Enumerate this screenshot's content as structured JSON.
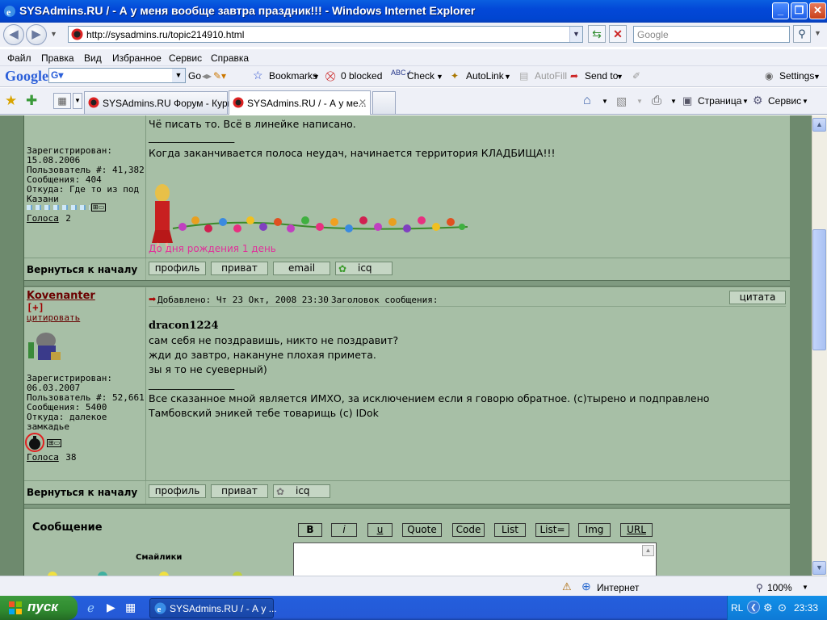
{
  "window": {
    "title": "SYSAdmins.RU / - А у меня вообще завтра праздник!!! - Windows Internet Explorer"
  },
  "address_bar": {
    "url": "http://sysadmins.ru/topic214910.html",
    "search_placeholder": "Google"
  },
  "menu": [
    "Файл",
    "Правка",
    "Вид",
    "Избранное",
    "Сервис",
    "Справка"
  ],
  "google_toolbar": {
    "logo": "Google",
    "go": "Go",
    "bookmarks": "Bookmarks",
    "blocked": "0 blocked",
    "check": "Check",
    "autolink": "AutoLink",
    "autofill": "AutoFill",
    "sendto": "Send to",
    "settings": "Settings"
  },
  "tabs": [
    {
      "label": "SYSAdmins.RU Форум - Кури..."
    },
    {
      "label": "SYSAdmins.RU / - А у ме..."
    }
  ],
  "command_bar": {
    "page": "Страница",
    "service": "Сервис"
  },
  "post1": {
    "left": {
      "registered_label": "Зарегистрирован:",
      "registered": "15.08.2006",
      "user_num": "Пользователь #: 41,382",
      "messages": "Сообщения: 404",
      "from": "Откуда: Где то из под Казани",
      "votes_link": "Голоса",
      "votes_count": ": 2"
    },
    "lines": [
      "Чё писать то. Всё в линейке написано.",
      "_________________",
      "Когда заканчивается полоса неудач, начинается территория КЛАДБИЩА!!!"
    ],
    "banner_text": "До дня рождения 1 день",
    "back_to_top": "Вернуться к началу",
    "buttons": [
      "профиль",
      "приват",
      "email",
      "icq"
    ]
  },
  "post2": {
    "left": {
      "username": "Kovenanter",
      "plus": "[+]",
      "cite": "цитировать",
      "registered_label": "Зарегистрирован:",
      "registered": "06.03.2007",
      "user_num": "Пользователь #: 52,661",
      "messages": "Сообщения: 5400",
      "from": "Откуда: далекое замкадье",
      "votes_link": "Голоса",
      "votes_count": ": 38"
    },
    "header": {
      "added": "Добавлено: Чт 23 Окт, 2008 23:30",
      "subject": "Заголовок сообщения:",
      "quote_btn": "цитата"
    },
    "quote_author": "dracon1224",
    "lines": [
      "сам себя не поздравишь, никто не поздравит?",
      "жди до завтро, накануне плохая примета.",
      "зы я то не суеверный)"
    ],
    "signature": [
      "_________________",
      "Все сказанное мной является ИМХО, за исключением если я говорю обратное. (с)тырено и подправлено",
      "Тамбовский эникей тебе товарищь (с) IDok"
    ],
    "back_to_top": "Вернуться к началу",
    "buttons": [
      "профиль",
      "приват",
      "icq"
    ]
  },
  "reply": {
    "message_label": "Сообщение",
    "smileys_label": "Смайлики",
    "editor_buttons": [
      "B",
      "i",
      "u",
      "Quote",
      "Code",
      "List",
      "List=",
      "Img",
      "URL"
    ]
  },
  "status_bar": {
    "zone": "Интернет",
    "zoom": "100%"
  },
  "taskbar": {
    "start": "пуск",
    "task": "SYSAdmins.RU / - А у ...",
    "lang": "RL",
    "clock": "23:33"
  },
  "colors": {
    "forum_bg": "#a7bfa6",
    "forum_border": "#7f9a80",
    "username": "#6b0000",
    "xp_blue": "#0348d8"
  }
}
